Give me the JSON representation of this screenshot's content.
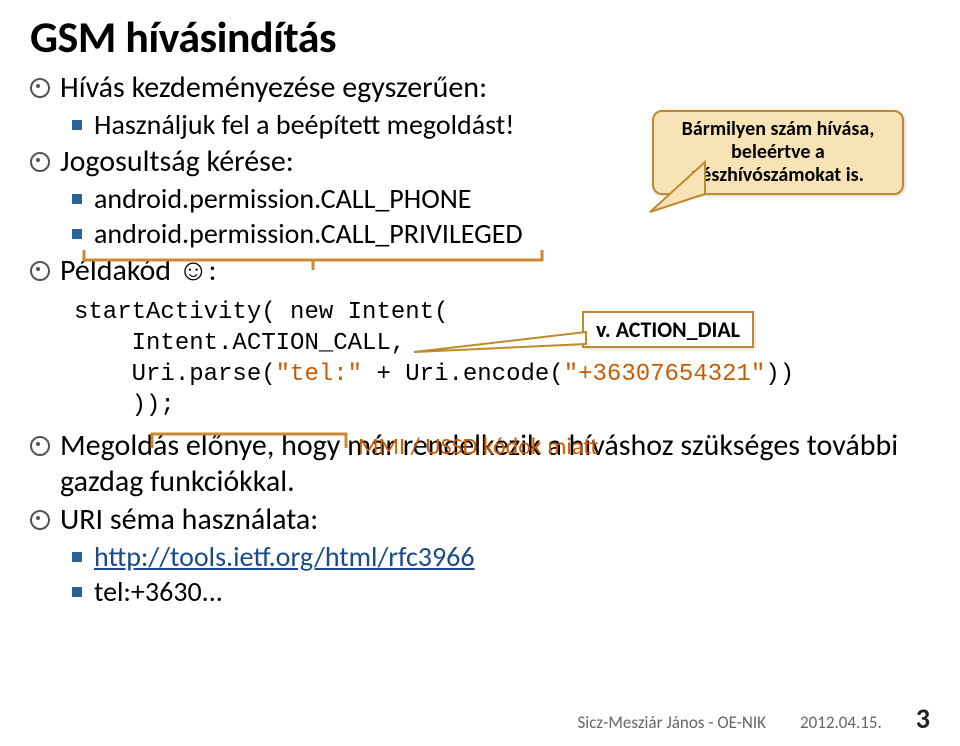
{
  "title": "GSM hívásindítás",
  "b1": "Hívás kezdeményezése egyszerűen:",
  "b1a": "Használjuk fel a beépített megoldást!",
  "b2": "Jogosultság kérése:",
  "b2a": "android.permission.CALL_PHONE",
  "b2b": "android.permission.CALL_PRIVILEGED",
  "b3": "Példakód ☺:",
  "code": {
    "l1": "startActivity( new Intent(",
    "l2": "    Intent.ACTION_CALL,",
    "l3a": "    Uri.parse(",
    "l3b": "\"tel:\"",
    "l3c": " + Uri.encode(",
    "l3d": "\"+36307654321\"",
    "l3e": "))",
    "l4": "    ));"
  },
  "callout_big": "Bármilyen szám hívása, beleértve a vészhívószámokat is.",
  "callout_small": "v. ACTION_DIAL",
  "anno": "MMI / USSD kódok miatt",
  "b4": "Megoldás előnye, hogy már rendelkezik a híváshoz szükséges további gazdag funkciókkal.",
  "b5": "URI séma használata:",
  "b5a": "http://tools.ietf.org/html/rfc3966",
  "b5b": "tel:+3630...",
  "footer_author": "Sicz-Mesziár János - OE-NIK",
  "footer_date": "2012.04.15.",
  "footer_page": "3"
}
